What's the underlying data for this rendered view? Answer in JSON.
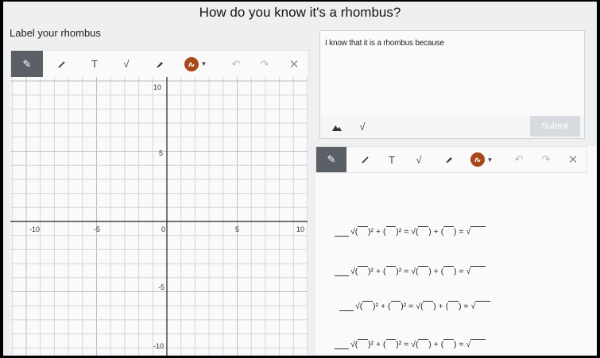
{
  "title": "How do you know it's a rhombus?",
  "left_label": "Label your rhombus",
  "draw_toolbar": {
    "text_tool": "T",
    "math_tool": "√",
    "undo": "↶",
    "redo": "↷",
    "clear": "✕",
    "color": "#a74818"
  },
  "graph": {
    "x_range": [
      -10,
      10
    ],
    "y_range": [
      -10,
      10
    ],
    "x_tick_labels": [
      "-10",
      "-5",
      "0",
      "5",
      "10"
    ],
    "y_tick_labels": [
      "10",
      "5",
      "-5",
      "-10"
    ]
  },
  "explain": {
    "prompt": "I know that it is a rhombus because",
    "math_tool": "√",
    "submit_label": "Submit"
  },
  "work_toolbar": {
    "text_tool": "T",
    "math_tool": "√",
    "undo": "↶",
    "redo": "↷",
    "clear": "✕"
  },
  "equations": [
    {
      "p1": "√(",
      "p2": ")² + (",
      "p3": ")² = √(",
      "p4": ") + (",
      "p5": ") = √"
    },
    {
      "p1": "√(",
      "p2": ")² + (",
      "p3": ")² = √(",
      "p4": ") + (",
      "p5": ") = √"
    },
    {
      "p1": "√(",
      "p2": ")² + (",
      "p3": ")² = √(",
      "p4": ") + (",
      "p5": ") = √"
    },
    {
      "p1": "√(",
      "p2": ")² + (",
      "p3": ")² = √(",
      "p4": ") + (",
      "p5": ") = √"
    }
  ]
}
